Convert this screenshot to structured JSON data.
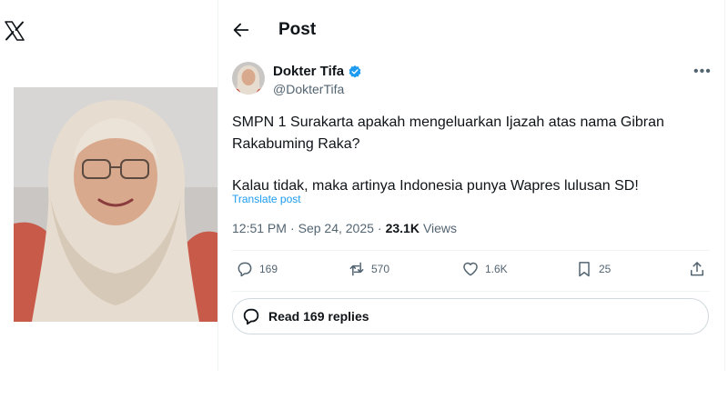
{
  "brand": {
    "logo_icon": "x-logo-icon"
  },
  "header": {
    "title": "Post",
    "back_icon": "arrow-left-icon"
  },
  "author": {
    "name": "Dokter Tifa",
    "handle": "@DokterTifa",
    "verified": true,
    "verified_color": "#1d9bf0"
  },
  "post": {
    "paragraphs": [
      "SMPN 1 Surakarta apakah mengeluarkan Ijazah atas nama Gibran Rakabuming Raka?",
      "Kalau tidak, maka artinya Indonesia punya Wapres lulusan SD!"
    ],
    "translate_label": "Translate post",
    "time": "12:51 PM",
    "separator": "·",
    "date": "Sep 24, 2025",
    "views_count": "23.1K",
    "views_label": "Views"
  },
  "actions": {
    "replies": "169",
    "reposts": "570",
    "likes": "1.6K",
    "bookmarks": "25"
  },
  "read_replies_label": "Read 169 replies",
  "colors": {
    "accent": "#1d9bf0",
    "text": "#0f1419",
    "muted": "#536471"
  }
}
